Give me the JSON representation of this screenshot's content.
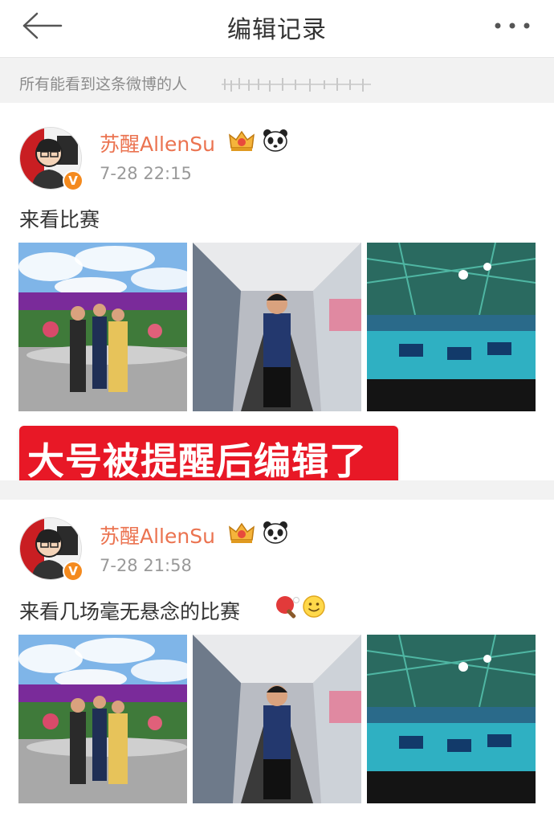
{
  "header": {
    "title": "编辑记录",
    "back_icon": "back-arrow-icon",
    "more_icon": "more-dots-icon"
  },
  "visibility": {
    "text": "所有能看到这条微博的人"
  },
  "caption": {
    "text": "大号被提醒后编辑了",
    "color": "#e81826"
  },
  "posts": [
    {
      "username": "苏醒AllenSu",
      "time": "7-28 22:15",
      "content": "来看比赛",
      "photos": [
        "outdoor-group-photo",
        "escalator-portrait-photo",
        "arena-panorama-photo"
      ]
    },
    {
      "username": "苏醒AllenSu",
      "time": "7-28 21:58",
      "content": "来看几场毫无悬念的比赛",
      "emojis": [
        "ping-pong-icon",
        "smile-icon"
      ],
      "photos": [
        "outdoor-group-photo",
        "escalator-portrait-photo",
        "arena-panorama-photo"
      ]
    }
  ],
  "colors": {
    "username": "#eb7350",
    "verified": "#f48a1e",
    "caption_bg": "#e81826",
    "divider": "#f2f2f2"
  }
}
